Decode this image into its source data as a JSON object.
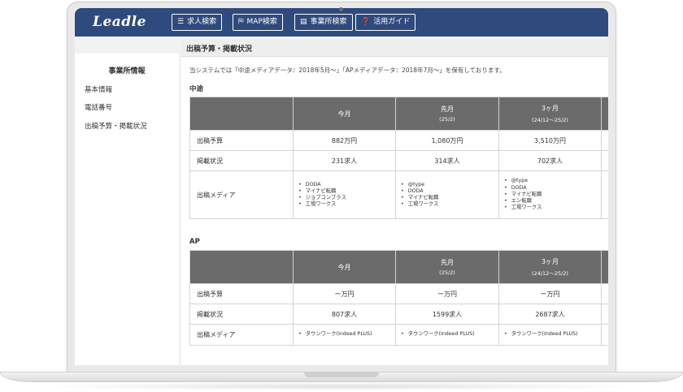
{
  "app": {
    "logo": "Leadle"
  },
  "nav": [
    {
      "icon": "☰",
      "icon_name": "menu-icon",
      "label": "求人検索"
    },
    {
      "icon": "⛿",
      "icon_name": "map-icon",
      "label": "MAP検索"
    },
    {
      "icon": "▤",
      "icon_name": "building-icon",
      "label": "事業所検索"
    },
    {
      "icon": "❓",
      "icon_name": "help-icon",
      "label": "活用ガイド"
    }
  ],
  "sidebar": {
    "title": "事業所情報",
    "items": [
      "基本情報",
      "電話番号",
      "出稿予算・掲載状況"
    ]
  },
  "content": {
    "header": "出稿予算・掲載状況",
    "note": "当システムでは「中途メディアデータ：2018年5月〜」「APメディアデータ：2018年7月〜」を保有しております。",
    "columns": [
      {
        "label": "今月",
        "sub": ""
      },
      {
        "label": "先月",
        "sub": "(25/2)"
      },
      {
        "label": "3ヶ月",
        "sub": "(24/12〜25/2)"
      }
    ],
    "sections": [
      {
        "label": "中途",
        "rows": {
          "budget_label": "出稿予算",
          "budget": [
            "882万円",
            "1,080万円",
            "3,510万円"
          ],
          "listing_label": "掲載状況",
          "listing": [
            "231求人",
            "314求人",
            "702求人"
          ],
          "media_label": "出稿メディア",
          "media": [
            [
              "DODA",
              "マイナビ転職",
              "ジョブコンプラス",
              "工場ワークス"
            ],
            [
              "@type",
              "DODA",
              "マイナビ転職",
              "工場ワークス"
            ],
            [
              "@type",
              "DODA",
              "マイナビ転職",
              "エン転職",
              "工場ワークス"
            ]
          ]
        }
      },
      {
        "label": "AP",
        "rows": {
          "budget_label": "出稿予算",
          "budget": [
            "ー万円",
            "ー万円",
            "ー万円"
          ],
          "listing_label": "掲載状況",
          "listing": [
            "807求人",
            "1599求人",
            "2687求人"
          ],
          "media_label": "出稿メディア",
          "media": [
            [
              "タウンワーク(Indeed PLUS)"
            ],
            [
              "タウンワーク(Indeed PLUS)"
            ],
            [
              "タウンワーク(Indeed PLUS)"
            ]
          ]
        }
      }
    ]
  }
}
